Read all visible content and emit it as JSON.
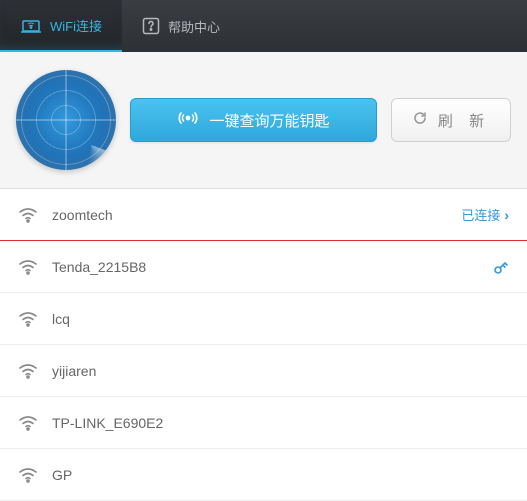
{
  "header": {
    "tab_wifi": "WiFi连接",
    "tab_help": "帮助中心"
  },
  "toolbar": {
    "scan_label": "一键查询万能钥匙",
    "refresh_label": "刷 新"
  },
  "connected_label": "已连接",
  "networks": [
    {
      "name": "zoomtech",
      "connected": true,
      "has_key": false
    },
    {
      "name": "Tenda_2215B8",
      "connected": false,
      "has_key": true
    },
    {
      "name": "lcq",
      "connected": false,
      "has_key": false
    },
    {
      "name": "yijiaren",
      "connected": false,
      "has_key": false
    },
    {
      "name": "TP-LINK_E690E2",
      "connected": false,
      "has_key": false
    },
    {
      "name": "GP",
      "connected": false,
      "has_key": false
    }
  ]
}
